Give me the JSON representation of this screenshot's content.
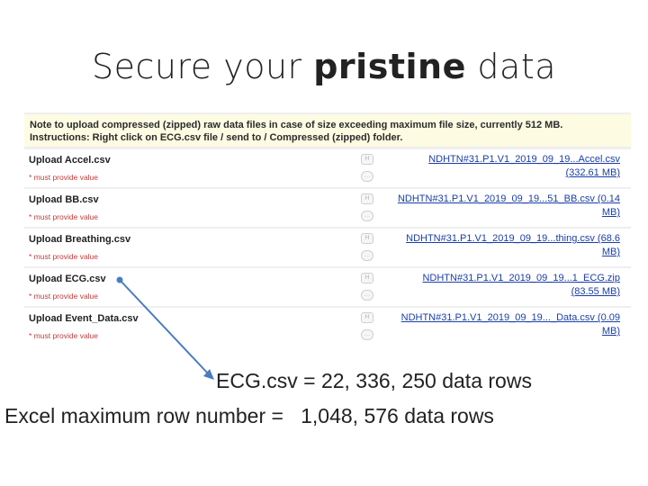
{
  "title": {
    "pre": "Secure your ",
    "bold": "pristine",
    "post": " data"
  },
  "note": {
    "line1": "Note to upload compressed (zipped) raw data files in case of size exceeding maximum file size, currently 512 MB.",
    "line2": "Instructions: Right click on ECG.csv file / send to / Compressed (zipped) folder."
  },
  "rows": [
    {
      "label": "Upload Accel.csv",
      "required": "* must provide value",
      "file": "NDHTN#31.P1.V1_2019_09_19...Accel.csv (332.61 MB)"
    },
    {
      "label": "Upload BB.csv",
      "required": "* must provide value",
      "file": "NDHTN#31.P1.V1_2019_09_19...51_BB.csv (0.14 MB)"
    },
    {
      "label": "Upload Breathing.csv",
      "required": "* must provide value",
      "file": "NDHTN#31.P1.V1_2019_09_19...thing.csv (68.6 MB)"
    },
    {
      "label": "Upload ECG.csv",
      "required": "* must provide value",
      "file": "NDHTN#31.P1.V1_2019_09_19...1_ECG.zip (83.55 MB)"
    },
    {
      "label": "Upload Event_Data.csv",
      "required": "* must provide value",
      "file": "NDHTN#31.P1.V1_2019_09_19..._Data.csv (0.09 MB)"
    }
  ],
  "icons": {
    "history": "history-icon",
    "comment": "comment-icon"
  },
  "stats": {
    "ecg": "ECG.csv = 22, 336, 250 data rows",
    "excel": "Excel maximum row number =   1,048, 576 data rows"
  },
  "colors": {
    "note_bg": "#fdfbe2",
    "link": "#1a3ea8",
    "required": "#c43b3b",
    "arrow": "#4a7cc0"
  }
}
